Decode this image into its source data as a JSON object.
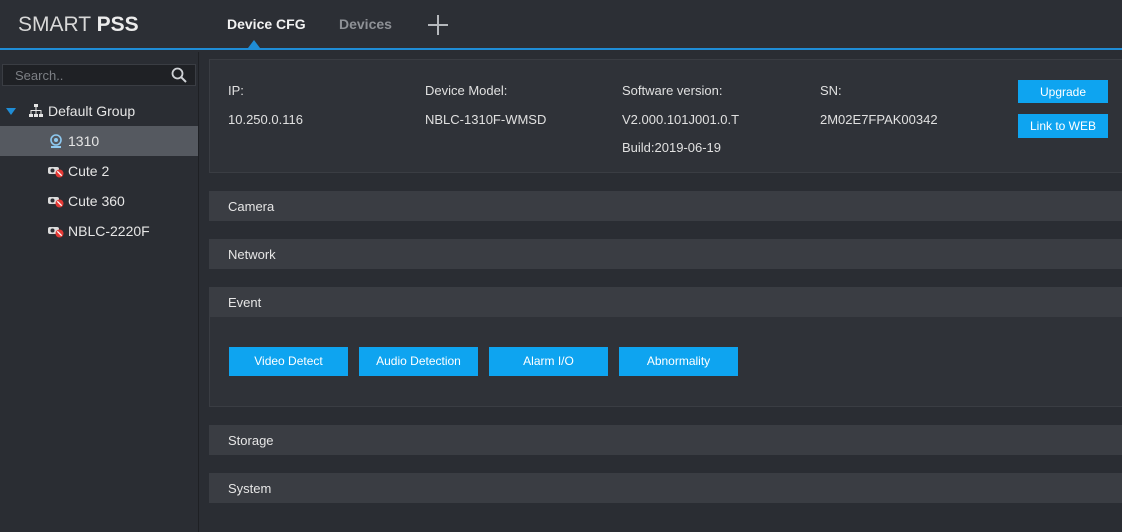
{
  "app": {
    "logo_main": "SMART ",
    "logo_bold": "PSS"
  },
  "tabs": [
    {
      "label": "Device CFG",
      "active": true
    },
    {
      "label": "Devices",
      "active": false
    }
  ],
  "sidebar": {
    "search_placeholder": "Search..",
    "group": {
      "label": "Default Group",
      "expanded": true
    },
    "devices": [
      {
        "label": "1310",
        "online": true,
        "selected": true
      },
      {
        "label": "Cute 2",
        "online": false
      },
      {
        "label": "Cute 360",
        "online": false
      },
      {
        "label": "NBLC-2220F",
        "online": false
      }
    ]
  },
  "device_info": {
    "ip_label": "IP:",
    "ip_value": "10.250.0.116",
    "model_label": "Device Model:",
    "model_value": "NBLC-1310F-WMSD",
    "software_label": "Software version:",
    "software_value": "V2.000.101J001.0.T",
    "build_value": "Build:2019-06-19",
    "sn_label": "SN:",
    "sn_value": "2M02E7FPAK00342",
    "upgrade_label": "Upgrade",
    "link_web_label": "Link to WEB"
  },
  "sections": {
    "camera": "Camera",
    "network": "Network",
    "event": "Event",
    "storage": "Storage",
    "system": "System"
  },
  "event_buttons": [
    "Video Detect",
    "Audio Detection",
    "Alarm I/O",
    "Abnormality"
  ],
  "colors": {
    "accent": "#1f8dd6",
    "button": "#0ea4f0",
    "offline_badge": "#e53935"
  }
}
